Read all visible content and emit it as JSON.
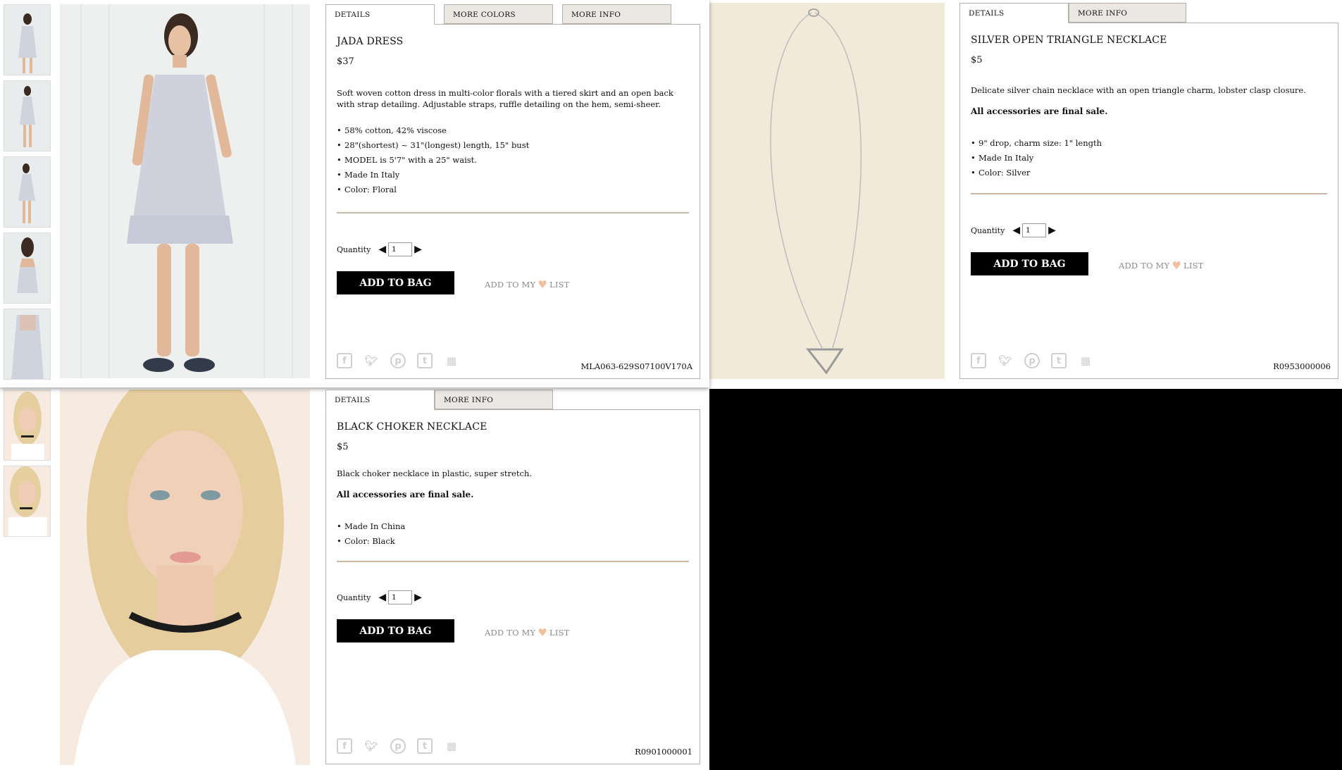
{
  "products": [
    {
      "tabs": [
        "DETAILS",
        "MORE COLORS",
        "MORE INFO"
      ],
      "name": "JADA DRESS",
      "price": "$37",
      "description": "Soft woven cotton dress in multi-color florals with a tiered skirt and an open back with strap detailing. Adjustable straps, ruffle detailing on the hem, semi-sheer.",
      "bullets": [
        "58% cotton, 42% viscose",
        "28\"(shortest) ~ 31\"(longest) length, 15\" bust",
        "MODEL is 5'7\" with a 25\" waist.",
        "Made In Italy",
        "Color: Floral"
      ],
      "quantity_label": "Quantity",
      "quantity_value": "1",
      "add_to_bag": "ADD TO BAG",
      "wishlist_prefix": "ADD TO MY",
      "wishlist_suffix": "LIST",
      "sku": "MLA063-629S07100V170A"
    },
    {
      "tabs": [
        "DETAILS",
        "MORE INFO"
      ],
      "name": "SILVER OPEN TRIANGLE NECKLACE",
      "price": "$5",
      "description": "Delicate silver chain necklace with an open triangle charm, lobster clasp closure.",
      "final_sale": "All accessories are final sale.",
      "bullets": [
        "9\" drop, charm size: 1\" length",
        "Made In Italy",
        "Color: Silver"
      ],
      "quantity_label": "Quantity",
      "quantity_value": "1",
      "add_to_bag": "ADD TO BAG",
      "wishlist_prefix": "ADD TO MY",
      "wishlist_suffix": "LIST",
      "sku": "R0953000006"
    },
    {
      "tabs": [
        "DETAILS",
        "MORE INFO"
      ],
      "name": "BLACK CHOKER NECKLACE",
      "price": "$5",
      "description": "Black choker necklace in plastic, super stretch.",
      "final_sale": "All accessories are final sale.",
      "bullets": [
        "Made In China",
        "Color: Black"
      ],
      "quantity_label": "Quantity",
      "quantity_value": "1",
      "add_to_bag": "ADD TO BAG",
      "wishlist_prefix": "ADD TO MY",
      "wishlist_suffix": "LIST",
      "sku": "R0901000001"
    }
  ],
  "social_icons": [
    "facebook-icon",
    "twitter-icon",
    "pinterest-icon",
    "tumblr-icon",
    "grid-icon"
  ],
  "colors": {
    "button_bg": "#000000",
    "heart": "#f2bf9e",
    "divider": "#c8b6a6",
    "tab_bg": "#ebe8e4",
    "muted_text": "#8a8a8a"
  }
}
